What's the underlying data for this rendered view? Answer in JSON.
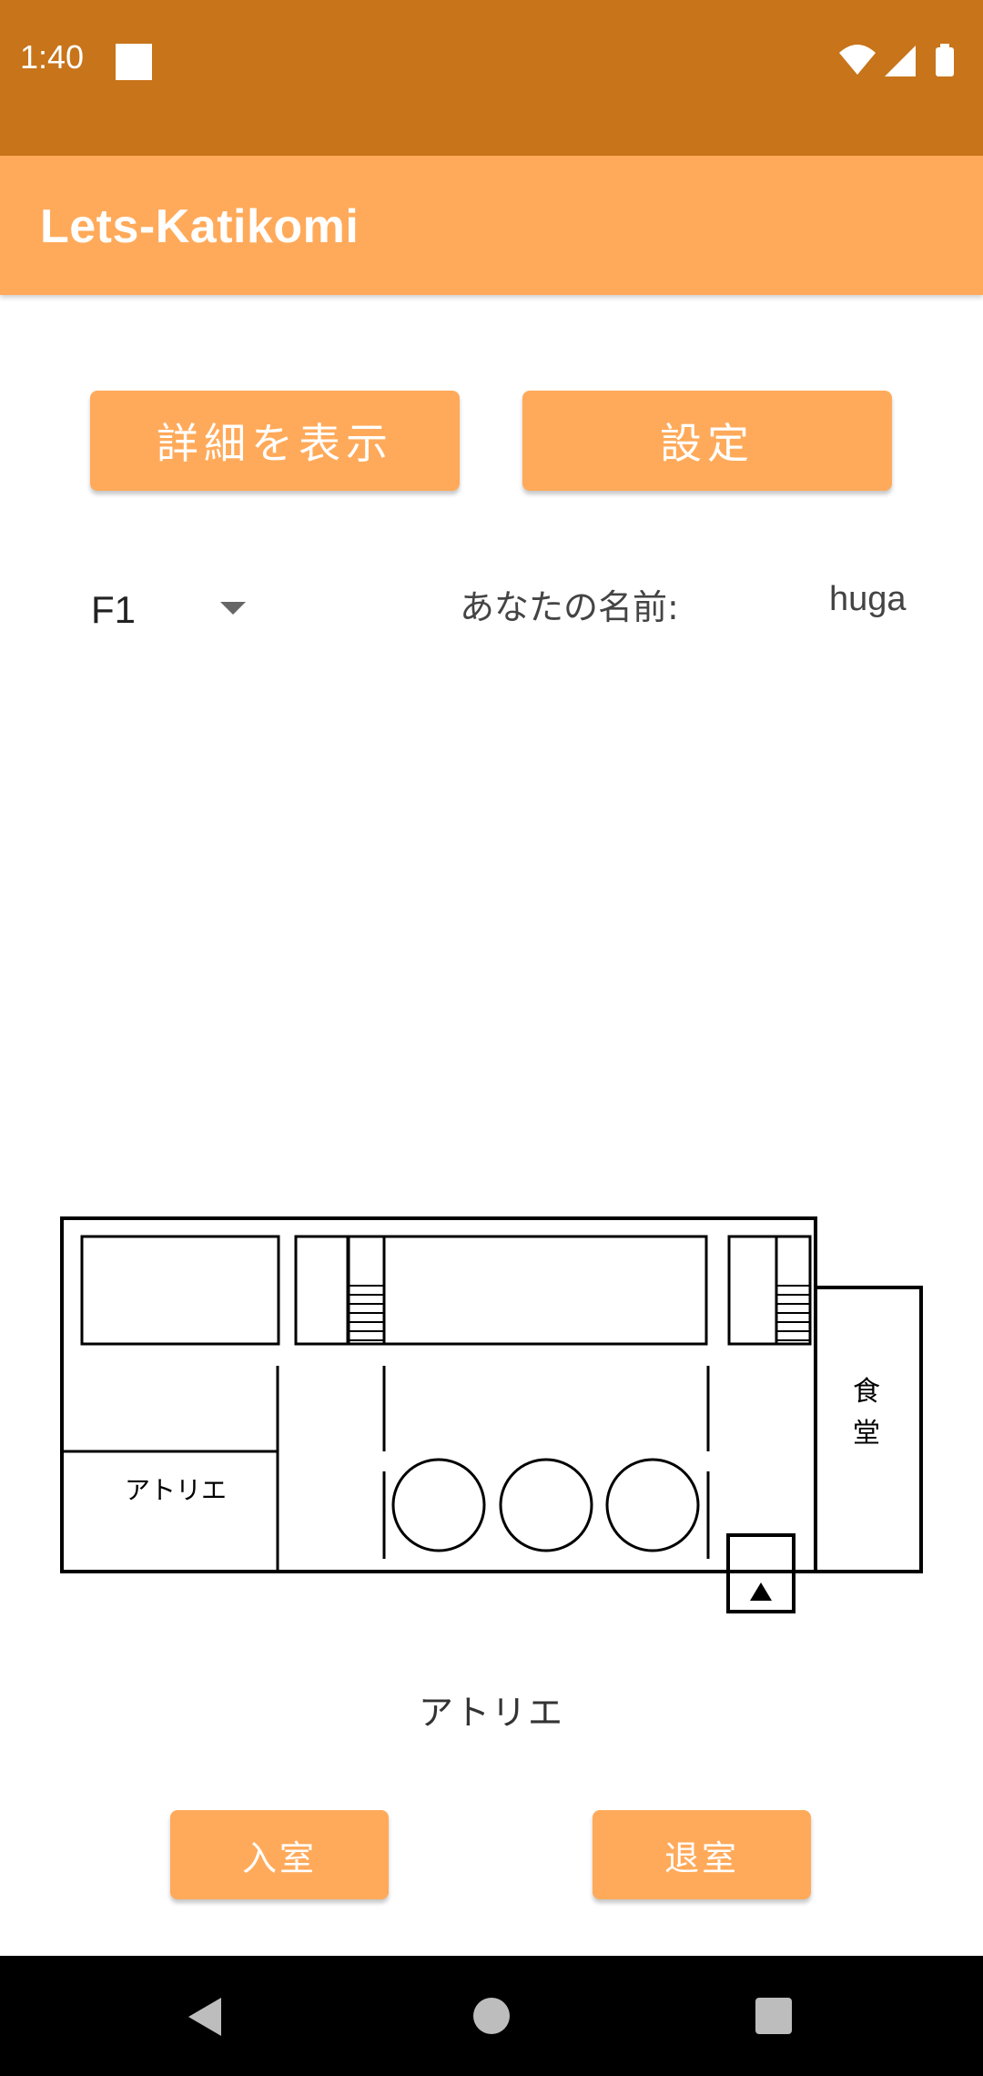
{
  "status_bar": {
    "time": "1:40",
    "icons": [
      "wifi-icon",
      "signal-icon",
      "battery-icon"
    ]
  },
  "app_bar": {
    "title": "Lets-Katikomi",
    "color": "#FFAA5A",
    "status_color": "#C8741A"
  },
  "buttons": {
    "details": "詳細を表示",
    "settings": "設定",
    "enter": "入室",
    "exit": "退室"
  },
  "floor_select": {
    "value": "F1"
  },
  "user": {
    "label": "あなたの名前:",
    "name": "huga"
  },
  "map": {
    "rooms": {
      "atelier": "アトリエ",
      "cafeteria_1": "食",
      "cafeteria_2": "堂"
    }
  },
  "selected_room": "アトリエ",
  "nav_bar": {
    "icons": [
      "back-icon",
      "home-icon",
      "recents-icon"
    ]
  }
}
